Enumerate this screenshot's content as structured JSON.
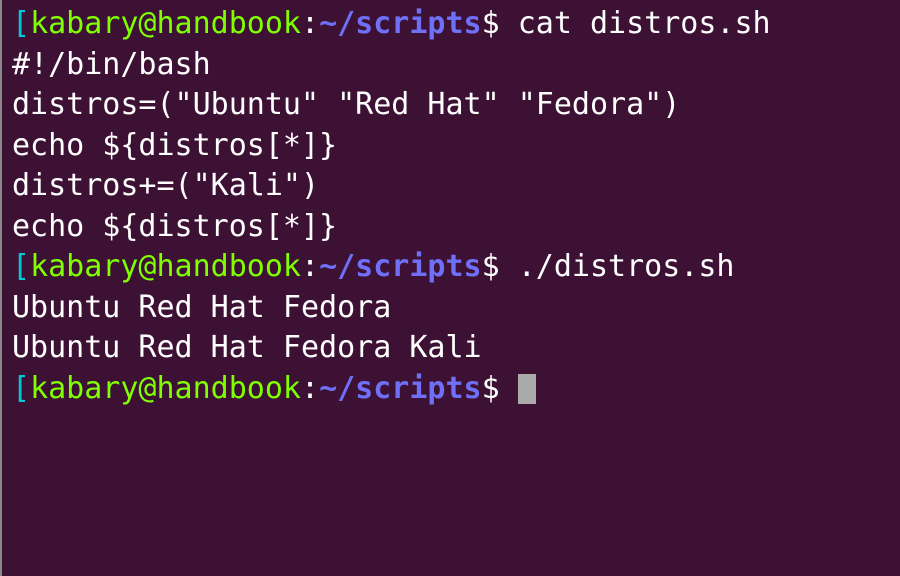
{
  "prompt": {
    "bracket": "[",
    "user": "kabary@handbook",
    "colon": ":",
    "path": "~/scripts",
    "dollar": "$"
  },
  "commands": {
    "cat": "cat distros.sh",
    "run": "./distros.sh"
  },
  "script": {
    "shebang": "#!/bin/bash",
    "blank": "",
    "assign": "distros=(\"Ubuntu\" \"Red Hat\" \"Fedora\")",
    "echo1": "echo ${distros[*]}",
    "append": "distros+=(\"Kali\")",
    "echo2": "echo ${distros[*]}"
  },
  "output": {
    "line1": "Ubuntu Red Hat Fedora",
    "line2": "Ubuntu Red Hat Fedora Kali"
  }
}
